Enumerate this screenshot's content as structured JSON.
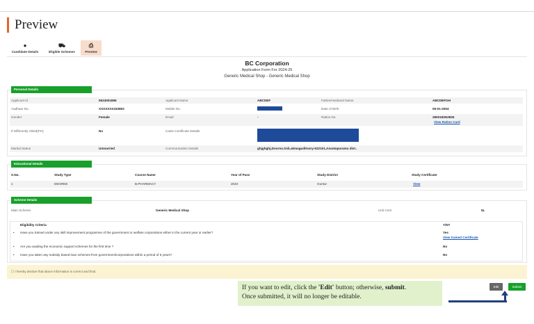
{
  "page": {
    "title": "Preview"
  },
  "tabs": [
    {
      "label": "Candidate Details",
      "icon": "person-icon"
    },
    {
      "label": "Eligible Schemes",
      "icon": "bank-icon"
    },
    {
      "label": "Preview",
      "icon": "printer-icon"
    }
  ],
  "header": {
    "corporation": "BC Corporation",
    "form_line": "Application Form For 2024-25",
    "shop_line": "Generic Medical Shop - Generic Medical Shop"
  },
  "personal": {
    "section_label": "Personal Details",
    "applicant_id_label": "Applicant Id",
    "applicant_id": "0624001856",
    "applicant_name_label": "Applicant Name",
    "applicant_name": "ABCDEF",
    "father_label": "Father/Husband Name",
    "father_name": "ABCDEFGH",
    "aadhaar_label": "Aadhaar No.",
    "aadhaar": "XXXXXXX333802",
    "mobile_label": "Mobile No.",
    "dob_label": "Date of Birth",
    "dob": "05-01-2004",
    "gender_label": "Gender",
    "gender": "Female",
    "email_label": "Email",
    "email": "-",
    "ration_label": "Ration No.",
    "ration": "2800182N2835",
    "ration_link": "View Ration Card",
    "pwd_label": "If Differently Abled(PH)",
    "pwd": "No",
    "caste_label": "Caste Certificate Details",
    "marital_label": "Marital Status",
    "marital": "Unmarried",
    "comm_label": "Communication Details",
    "comm": "ghjghghj,Doorno.Ss/Lakmaguditoory-522101,Anantapuramu dist.."
  },
  "education": {
    "section_label": "Educational Details",
    "headers": [
      "S.No.",
      "Study Type",
      "Course Name",
      "Year of Pass",
      "Study District",
      "Study Certificate"
    ],
    "rows": [
      {
        "sno": "1",
        "type": "DEGREE",
        "course": "B.PHARMACY",
        "year": "2023",
        "district": "Guntur",
        "cert": "View"
      }
    ]
  },
  "scheme": {
    "section_label": "Scheme Details",
    "name_label": "Main Scheme",
    "name": "Generic Medical Shop",
    "cost_label": "Unit Cost",
    "cost": "5L",
    "eligibility_title": "Eligibility Criteria",
    "yn_header": "Y/N?",
    "criteria": [
      {
        "q": "Have you trained under any skill improvement programme of the government or welfare corporations either in the current year or earlier?",
        "a": "Yes",
        "link": "View trained Certificate"
      },
      {
        "q": "Are you availing the economic support schemes for the first time ?",
        "a": "No"
      },
      {
        "q": "Have you taken any subsidy based loan schemes from government/corporations within a period of 5 years?",
        "a": "No"
      }
    ]
  },
  "declaration": "I hereby declare that above information is correct and final.",
  "note": {
    "line1_pre": "If you want to edit, click the ",
    "line1_edit": "'Edit'",
    "line1_mid": " button; otherwise, ",
    "line1_submit": "submit",
    "line1_end": ".",
    "line2": "Once submitted, it will no longer be editable."
  },
  "buttons": {
    "edit": "Edit",
    "submit": "Submit"
  },
  "colors": {
    "accent": "#e0662b",
    "green": "#18a02a",
    "link": "#1a57b4",
    "mask": "#1e4a9a"
  }
}
